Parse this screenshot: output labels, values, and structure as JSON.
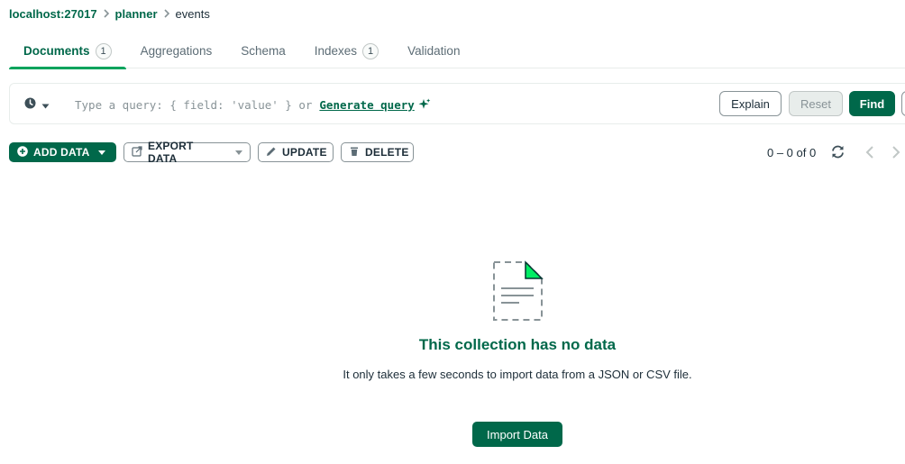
{
  "breadcrumb": {
    "host": "localhost:27017",
    "database": "planner",
    "collection": "events"
  },
  "tabs": [
    {
      "label": "Documents",
      "badge": "1",
      "active": true
    },
    {
      "label": "Aggregations"
    },
    {
      "label": "Schema"
    },
    {
      "label": "Indexes",
      "badge": "1"
    },
    {
      "label": "Validation"
    }
  ],
  "query": {
    "placeholder": "Type a query: { field: 'value' } or",
    "generate_label": "Generate query",
    "explain_label": "Explain",
    "reset_label": "Reset",
    "find_label": "Find"
  },
  "toolbar": {
    "add_data": "ADD DATA",
    "export_data": "EXPORT DATA",
    "update": "UPDATE",
    "delete": "DELETE"
  },
  "pagination": {
    "range": "0 – 0 of 0"
  },
  "empty_state": {
    "title": "This collection has no data",
    "description": "It only takes a few seconds to import data from a JSON or CSV file.",
    "import_label": "Import Data"
  },
  "icons": [
    "clock-icon",
    "caret-down-icon",
    "sparkle-icon",
    "plus-circle-icon",
    "export-icon",
    "pencil-icon",
    "trash-icon",
    "refresh-icon",
    "chevron-left-icon",
    "chevron-right-icon",
    "empty-document-icon"
  ],
  "colors": {
    "brand_green": "#00684a",
    "tab_underline": "#00a35c",
    "icon_accent": "#00ed64"
  }
}
